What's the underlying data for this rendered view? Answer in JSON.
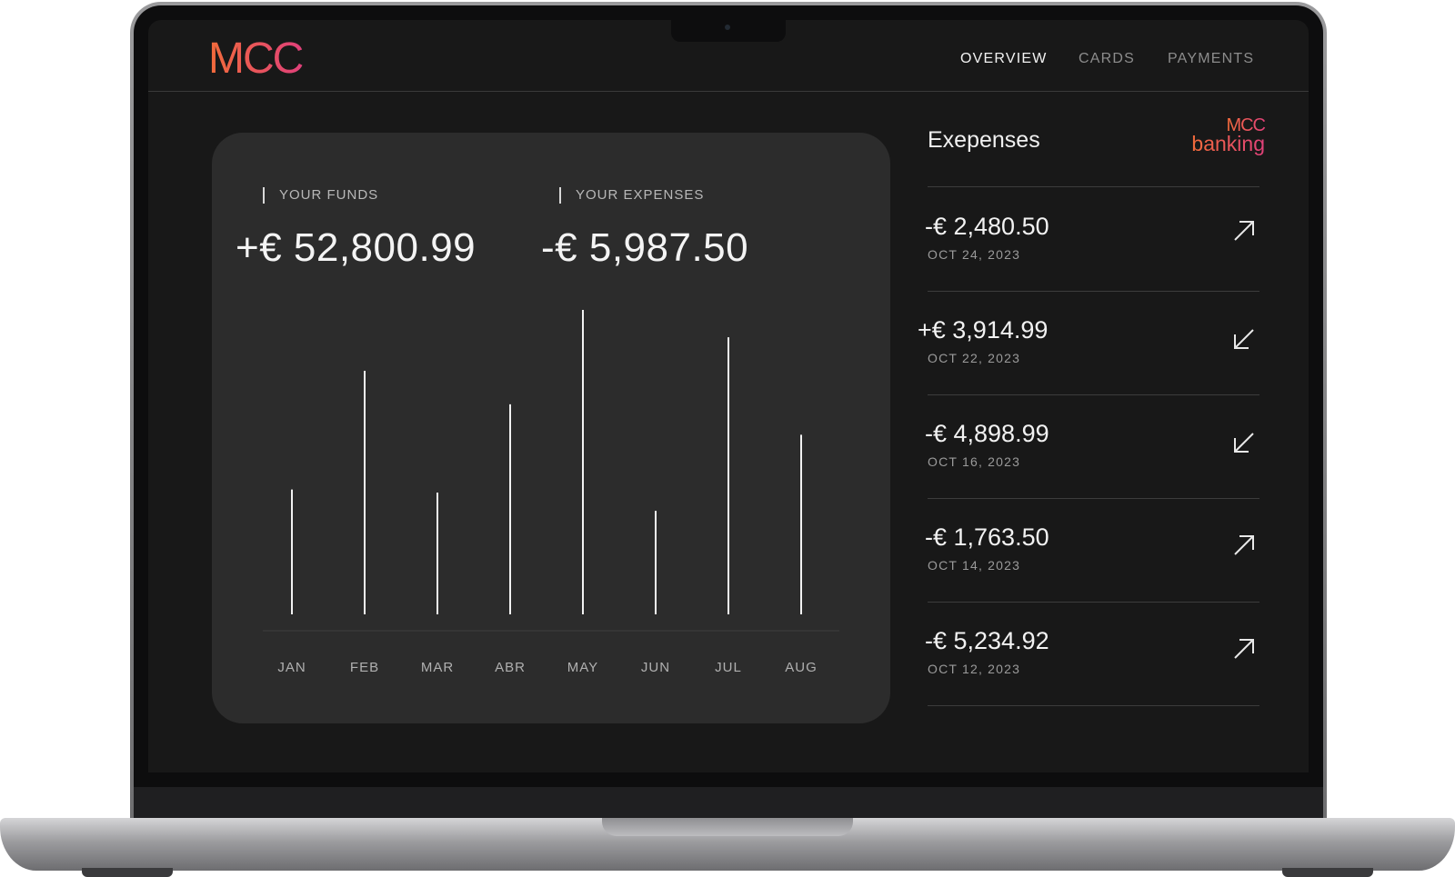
{
  "app": {
    "logo_text": "MCC",
    "nav": [
      {
        "label": "OVERVIEW",
        "active": true
      },
      {
        "label": "CARDS",
        "active": false
      },
      {
        "label": "PAYMENTS",
        "active": false
      }
    ]
  },
  "summary": {
    "funds_label": "YOUR FUNDS",
    "funds_value": "+€ 52,800.99",
    "expenses_label": "YOUR EXPENSES",
    "expenses_value": "-€ 5,987.50"
  },
  "chart_data": {
    "type": "bar",
    "categories": [
      "JAN",
      "FEB",
      "MAR",
      "ABR",
      "MAY",
      "JUN",
      "JUL",
      "AUG"
    ],
    "values": [
      41,
      80,
      40,
      69,
      100,
      34,
      91,
      59
    ],
    "ylim": [
      0,
      100
    ],
    "grid": false
  },
  "expenses_panel": {
    "title": "Exepenses",
    "brand_top": "MCC",
    "brand_bottom": "banking",
    "items": [
      {
        "amount": "-€ 2,480.50",
        "date": "OCT 24, 2023",
        "direction": "outgoing",
        "icon": "arrow-up-right-icon"
      },
      {
        "amount": "+€ 3,914.99",
        "date": "OCT 22, 2023",
        "direction": "incoming",
        "icon": "arrow-down-left-icon"
      },
      {
        "amount": "-€ 4,898.99",
        "date": "OCT 16, 2023",
        "direction": "incoming",
        "icon": "arrow-down-left-icon"
      },
      {
        "amount": "-€ 1,763.50",
        "date": "OCT 14, 2023",
        "direction": "outgoing",
        "icon": "arrow-up-right-icon"
      },
      {
        "amount": "-€ 5,234.92",
        "date": "OCT 12, 2023",
        "direction": "outgoing",
        "icon": "arrow-up-right-icon"
      }
    ]
  },
  "colors": {
    "brand_gradient_start": "#f26b3a",
    "brand_gradient_end": "#e0407a",
    "screen_bg": "#181818",
    "card_bg": "#2c2c2c"
  }
}
